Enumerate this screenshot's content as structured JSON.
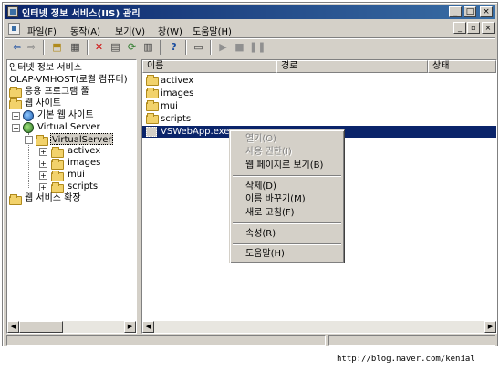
{
  "window": {
    "title": "인터넷 정보 서비스(IIS) 관리",
    "controls": {
      "minimize": "_",
      "maximize": "□",
      "close": "×"
    }
  },
  "menubar": {
    "items": [
      {
        "label": "파일(F)"
      },
      {
        "label": "동작(A)"
      },
      {
        "label": "보기(V)"
      },
      {
        "label": "창(W)"
      },
      {
        "label": "도움말(H)"
      }
    ],
    "mdi_controls": {
      "minimize": "_",
      "restore": "▫",
      "close": "×"
    }
  },
  "toolbar": {
    "buttons": [
      "back-icon",
      "forward-icon",
      "up-folder-icon",
      "show-hide-tree-icon",
      "delete-icon",
      "properties-icon",
      "refresh-icon",
      "export-list-icon",
      "help-icon",
      "computer-icon",
      "start-icon",
      "stop-icon",
      "pause-icon"
    ]
  },
  "tree": {
    "root": "인터넷 정보 서비스",
    "computer": "OLAP-VMHOST(로컬 컴퓨터)",
    "app_pools": "응용 프로그램 풀",
    "web_sites": "웹 사이트",
    "default_site": "기본 웹 사이트",
    "virtual_server": "Virtual Server",
    "virtual_server_child": "VirtualServer",
    "children": [
      "activex",
      "images",
      "mui",
      "scripts"
    ],
    "ext": "웹 서비스 확장",
    "expand_plus": "+",
    "expand_minus": "−"
  },
  "list": {
    "columns": [
      "이름",
      "경로",
      "상태"
    ],
    "rows": [
      {
        "name": "activex",
        "type": "folder"
      },
      {
        "name": "images",
        "type": "folder"
      },
      {
        "name": "mui",
        "type": "folder"
      },
      {
        "name": "scripts",
        "type": "folder"
      },
      {
        "name": "VSWebApp.exe",
        "type": "file",
        "selected": true
      }
    ]
  },
  "context_menu": {
    "items": [
      {
        "label": "열기(O)",
        "enabled": false
      },
      {
        "label": "사용 권한(I)",
        "enabled": false
      },
      {
        "label": "웹 페이지로 보기(B)",
        "enabled": true
      },
      {
        "label": "삭제(D)",
        "enabled": true
      },
      {
        "label": "이름 바꾸기(M)",
        "enabled": true
      },
      {
        "label": "새로 고침(F)",
        "enabled": true
      },
      {
        "label": "속성(R)",
        "enabled": true
      },
      {
        "label": "도움말(H)",
        "enabled": true
      }
    ]
  },
  "scroll": {
    "left": "◀",
    "right": "▶"
  },
  "watermark": "http://blog.naver.com/kenial",
  "colors": {
    "title_active": "#0a246a",
    "face": "#d4d0c8",
    "selection": "#0a246a",
    "folder": "#f2d26b"
  }
}
